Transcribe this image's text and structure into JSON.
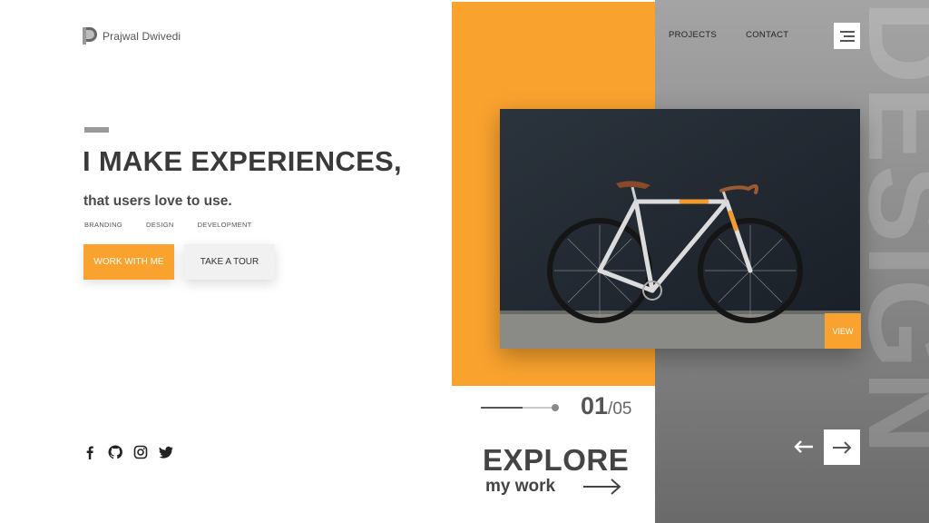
{
  "brand": {
    "name": "Prajwal Dwivedi",
    "icon": "logo-p-icon"
  },
  "hero": {
    "headline": "I MAKE EXPERIENCES,",
    "subline": "that users love to use.",
    "tags": [
      "BRANDING",
      "DESIGN",
      "DEVELOPMENT"
    ],
    "primary_cta": "WORK WITH ME",
    "secondary_cta": "TAKE A TOUR"
  },
  "nav": {
    "items": [
      "PROJECTS",
      "CONTACT"
    ],
    "menu_icon": "hamburger-icon"
  },
  "side_word": "DESIGN",
  "card": {
    "view_label": "VIEW",
    "image": "bicycle-photo"
  },
  "pager": {
    "current": "01",
    "total": "/05",
    "progress": 0.58
  },
  "explore": {
    "title": "EXPLORE",
    "subtitle": "my work",
    "arrow_icon": "arrow-right-icon"
  },
  "socials": [
    "facebook-icon",
    "github-icon",
    "instagram-icon",
    "twitter-icon"
  ],
  "colors": {
    "accent": "#f9a22e",
    "text_dark": "#3a3a3a",
    "panel_gray": "#8c8c8c"
  }
}
